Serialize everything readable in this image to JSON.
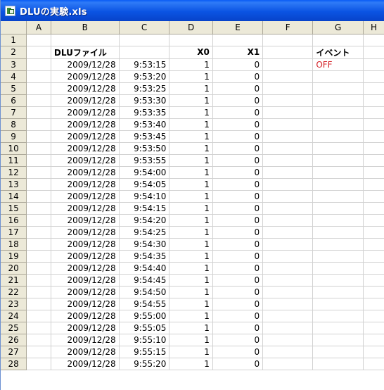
{
  "window": {
    "title": "DLUの実験.xls",
    "icon": "excel-workbook-icon"
  },
  "columns": [
    "A",
    "B",
    "C",
    "D",
    "E",
    "F",
    "G",
    "H"
  ],
  "header_row": {
    "row": "2",
    "b": "DLUファイル",
    "d": "X0",
    "e": "X1",
    "g": "イベント"
  },
  "event_status": {
    "value": "OFF",
    "color": "#d4242a"
  },
  "rows": [
    {
      "row": "3",
      "date": "2009/12/28",
      "time": "9:53:15",
      "x0": "1",
      "x1": "0"
    },
    {
      "row": "4",
      "date": "2009/12/28",
      "time": "9:53:20",
      "x0": "1",
      "x1": "0"
    },
    {
      "row": "5",
      "date": "2009/12/28",
      "time": "9:53:25",
      "x0": "1",
      "x1": "0"
    },
    {
      "row": "6",
      "date": "2009/12/28",
      "time": "9:53:30",
      "x0": "1",
      "x1": "0"
    },
    {
      "row": "7",
      "date": "2009/12/28",
      "time": "9:53:35",
      "x0": "1",
      "x1": "0"
    },
    {
      "row": "8",
      "date": "2009/12/28",
      "time": "9:53:40",
      "x0": "1",
      "x1": "0"
    },
    {
      "row": "9",
      "date": "2009/12/28",
      "time": "9:53:45",
      "x0": "1",
      "x1": "0"
    },
    {
      "row": "10",
      "date": "2009/12/28",
      "time": "9:53:50",
      "x0": "1",
      "x1": "0"
    },
    {
      "row": "11",
      "date": "2009/12/28",
      "time": "9:53:55",
      "x0": "1",
      "x1": "0"
    },
    {
      "row": "12",
      "date": "2009/12/28",
      "time": "9:54:00",
      "x0": "1",
      "x1": "0"
    },
    {
      "row": "13",
      "date": "2009/12/28",
      "time": "9:54:05",
      "x0": "1",
      "x1": "0"
    },
    {
      "row": "14",
      "date": "2009/12/28",
      "time": "9:54:10",
      "x0": "1",
      "x1": "0"
    },
    {
      "row": "15",
      "date": "2009/12/28",
      "time": "9:54:15",
      "x0": "1",
      "x1": "0"
    },
    {
      "row": "16",
      "date": "2009/12/28",
      "time": "9:54:20",
      "x0": "1",
      "x1": "0"
    },
    {
      "row": "17",
      "date": "2009/12/28",
      "time": "9:54:25",
      "x0": "1",
      "x1": "0"
    },
    {
      "row": "18",
      "date": "2009/12/28",
      "time": "9:54:30",
      "x0": "1",
      "x1": "0"
    },
    {
      "row": "19",
      "date": "2009/12/28",
      "time": "9:54:35",
      "x0": "1",
      "x1": "0"
    },
    {
      "row": "20",
      "date": "2009/12/28",
      "time": "9:54:40",
      "x0": "1",
      "x1": "0"
    },
    {
      "row": "21",
      "date": "2009/12/28",
      "time": "9:54:45",
      "x0": "1",
      "x1": "0"
    },
    {
      "row": "22",
      "date": "2009/12/28",
      "time": "9:54:50",
      "x0": "1",
      "x1": "0"
    },
    {
      "row": "23",
      "date": "2009/12/28",
      "time": "9:54:55",
      "x0": "1",
      "x1": "0"
    },
    {
      "row": "24",
      "date": "2009/12/28",
      "time": "9:55:00",
      "x0": "1",
      "x1": "0"
    },
    {
      "row": "25",
      "date": "2009/12/28",
      "time": "9:55:05",
      "x0": "1",
      "x1": "0"
    },
    {
      "row": "26",
      "date": "2009/12/28",
      "time": "9:55:10",
      "x0": "1",
      "x1": "0"
    },
    {
      "row": "27",
      "date": "2009/12/28",
      "time": "9:55:15",
      "x0": "1",
      "x1": "0"
    },
    {
      "row": "28",
      "date": "2009/12/28",
      "time": "9:55:20",
      "x0": "1",
      "x1": "0"
    }
  ]
}
